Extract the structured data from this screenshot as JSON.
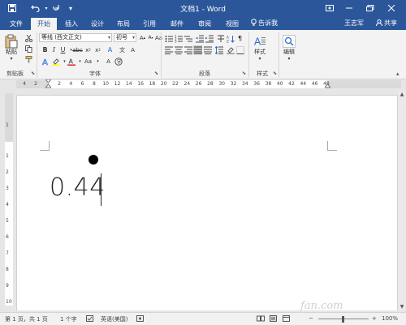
{
  "titlebar": {
    "title": "文档1 - Word",
    "save_icon": "save-icon",
    "undo_icon": "undo-icon",
    "redo_icon": "redo-icon",
    "customize_icon": "customize-qat-icon"
  },
  "tabs": [
    {
      "label": "文件"
    },
    {
      "label": "开始"
    },
    {
      "label": "插入"
    },
    {
      "label": "设计"
    },
    {
      "label": "布局"
    },
    {
      "label": "引用"
    },
    {
      "label": "邮件"
    },
    {
      "label": "审阅"
    },
    {
      "label": "视图"
    }
  ],
  "tell_me": "告诉我",
  "user_name": "王志军",
  "share_label": "共享",
  "ribbon": {
    "clipboard": {
      "paste_label": "粘贴",
      "group_label": "剪贴板"
    },
    "font": {
      "font_name": "等线 (西文正文)",
      "font_size": "初号",
      "group_label": "字体"
    },
    "paragraph": {
      "group_label": "段落"
    },
    "styles": {
      "styles_label": "样式",
      "group_label": "样式"
    },
    "editing": {
      "editing_label": "编辑"
    }
  },
  "ruler": {
    "tab_selector": "L",
    "left_numbers": [
      "4",
      "2"
    ],
    "numbers": [
      "2",
      "4",
      "6",
      "8",
      "10",
      "12",
      "14",
      "16",
      "18",
      "20",
      "22",
      "24",
      "26",
      "28",
      "30",
      "32",
      "34",
      "36",
      "38",
      "40",
      "42",
      "44",
      "46",
      "48"
    ]
  },
  "vruler": {
    "numbers": [
      "1",
      "1",
      "2",
      "3",
      "4",
      "5",
      "6",
      "7",
      "8",
      "9",
      "10"
    ]
  },
  "document": {
    "text": "0.44"
  },
  "statusbar": {
    "page": "第 1 页，共 1 页",
    "words": "1 个字",
    "language": "英语(美国)",
    "zoom": "100%"
  },
  "watermark": "fan.com"
}
